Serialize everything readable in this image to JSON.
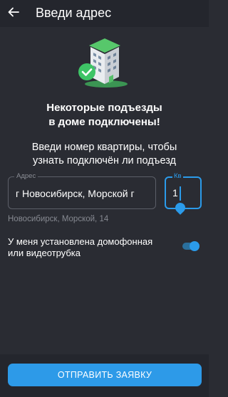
{
  "header": {
    "title": "Введи адрес",
    "back_icon": "arrow-left-icon"
  },
  "illustration": {
    "icon": "building-check-icon"
  },
  "message": {
    "headline_line1": "Некоторые подъезды",
    "headline_line2": "в доме подключены!",
    "hint_line1": "Введи номер квартиры, чтобы",
    "hint_line2": "узнать подключён ли подъезд"
  },
  "form": {
    "address_label": "Адрес",
    "address_value": "г Новосибирск, Морской г",
    "apartment_label": "Кв",
    "apartment_value": "1",
    "suggestion": "Новосибирск, Морской, 14"
  },
  "intercom": {
    "label_line1": "У меня установлена домофонная",
    "label_line2": "или видеотрубка",
    "enabled": true
  },
  "footer": {
    "submit_label": "ОТПРАВИТЬ ЗАЯВКУ"
  },
  "colors": {
    "background": "#2a2c33",
    "accent": "#2b9bea",
    "success": "#3ec466"
  }
}
